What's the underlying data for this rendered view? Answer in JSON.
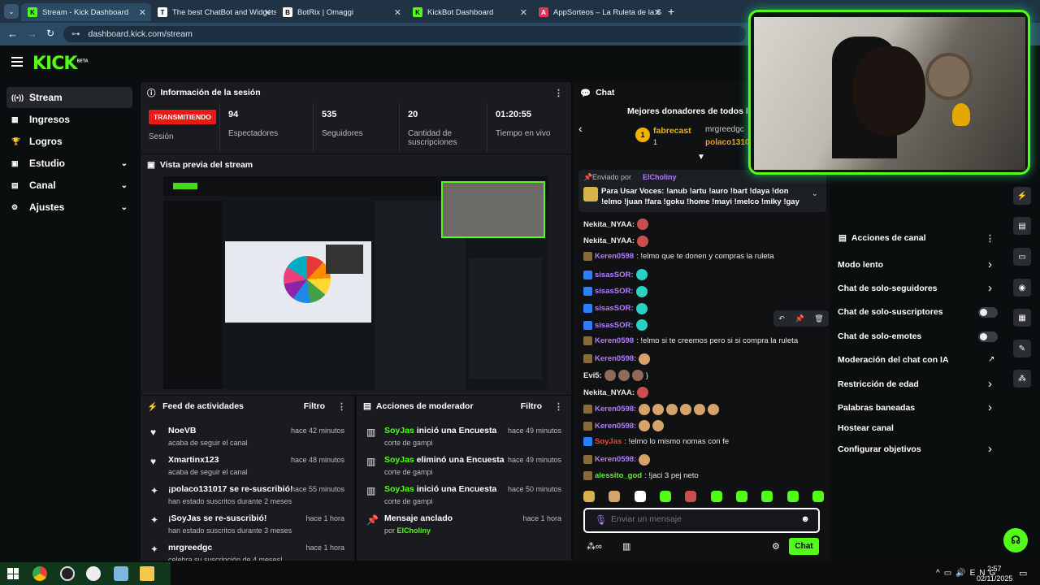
{
  "browser": {
    "tabs": [
      {
        "title": "Stream - Kick Dashboard",
        "fav": "K",
        "favbg": "#53fc18",
        "favfg": "#000"
      },
      {
        "title": "The best ChatBot and Widgets",
        "fav": "T",
        "favbg": "#ffffff",
        "favfg": "#000"
      },
      {
        "title": "BotRix | Omaggi",
        "fav": "B",
        "favbg": "#ffffff",
        "favfg": "#000"
      },
      {
        "title": "KickBot Dashboard",
        "fav": "K",
        "favbg": "#53fc18",
        "favfg": "#000"
      },
      {
        "title": "AppSorteos – La Ruleta de la S",
        "fav": "A",
        "favbg": "#d9385a",
        "favfg": "#fff"
      }
    ],
    "url": "dashboard.kick.com/stream"
  },
  "logo": {
    "text": "KICK",
    "sup": "BETA"
  },
  "sidebar": {
    "items": [
      {
        "label": "Stream",
        "icon": "broadcast-icon",
        "glyph": "((•))"
      },
      {
        "label": "Ingresos",
        "icon": "money-icon",
        "glyph": "▦"
      },
      {
        "label": "Logros",
        "icon": "trophy-icon",
        "glyph": "🏆"
      },
      {
        "label": "Estudio",
        "icon": "studio-icon",
        "glyph": "▣"
      },
      {
        "label": "Canal",
        "icon": "channel-icon",
        "glyph": "▤"
      },
      {
        "label": "Ajustes",
        "icon": "gear-icon",
        "glyph": "⚙"
      }
    ]
  },
  "session": {
    "title": "Información de la sesión",
    "live": "TRANSMITIENDO",
    "live_label": "Sesión",
    "stats": [
      {
        "value": "94",
        "label": "Espectadores"
      },
      {
        "value": "535",
        "label": "Seguidores"
      },
      {
        "value": "20",
        "label": "Cantidad de suscripciones"
      },
      {
        "value": "01:20:55",
        "label": "Tiempo en vivo"
      }
    ]
  },
  "preview": {
    "title": "Vista previa del stream"
  },
  "feed": {
    "title": "Feed de actividades",
    "filter": "Filtro",
    "items": [
      {
        "name": "NoeVB",
        "desc": "acaba de seguir el canal",
        "time": "hace 42 minutos",
        "icon": "heart-icon",
        "glyph": "♥"
      },
      {
        "name": "Xmartinx123",
        "desc": "acaba de seguir el canal",
        "time": "hace 48 minutos",
        "icon": "heart-icon",
        "glyph": "♥"
      },
      {
        "name": "¡polaco131017 se re-suscribió!",
        "desc": "han estado suscritos durante 2 meses",
        "time": "hace 55 minutos",
        "icon": "sparkle-icon",
        "glyph": "✦"
      },
      {
        "name": "¡SoyJas se re-suscribió!",
        "desc": "han estado suscritos durante 3 meses",
        "time": "hace 1 hora",
        "icon": "sparkle-icon",
        "glyph": "✦"
      },
      {
        "name": "mrgreedgc",
        "desc": "celebra su suscripción de 4 meses!",
        "time": "hace 1 hora",
        "icon": "sparkle-icon",
        "glyph": "✦"
      }
    ]
  },
  "modactions": {
    "title": "Acciones de moderador",
    "filter": "Filtro",
    "items": [
      {
        "user": "SoyJas",
        "action": " inició una Encuesta",
        "sub": "corte de gampi",
        "time": "hace 49 minutos",
        "icon": "poll-icon",
        "glyph": "▥"
      },
      {
        "user": "SoyJas",
        "action": " eliminó una Encuesta",
        "sub": "corte de gampi",
        "time": "hace 49 minutos",
        "icon": "poll-icon",
        "glyph": "▥"
      },
      {
        "user": "SoyJas",
        "action": " inició una Encuesta",
        "sub": "corte de gampi",
        "time": "hace 50 minutos",
        "icon": "poll-icon",
        "glyph": "▥"
      },
      {
        "user": "",
        "action": "Mensaje anclado",
        "sub_prefix": "por ",
        "sub": "ElCholiny",
        "time": "hace 1 hora",
        "icon": "pin-icon",
        "glyph": "📌"
      }
    ]
  },
  "chat": {
    "title": "Chat",
    "donors_title": "Mejores donadores de todos los t",
    "donor1": "fabrecast",
    "donor1_count": "1",
    "donor2": "mrgreedgc",
    "donor3": "polaco1310",
    "pinned_by_label": "Enviado por",
    "pinned_by": "ElCholiny",
    "pinned_text": "Para Usar Voces: !anub !artu !auro !bart !daya !don !elmo !juan !fara !goku !home !mayi !melco !miky !gay !mu...",
    "messages": [
      {
        "user": "Nekita_NYAA:",
        "color": "#e8e8e8",
        "text": "",
        "emotes": 1
      },
      {
        "user": "Nekita_NYAA:",
        "color": "#e8e8e8",
        "text": "",
        "emotes": 1
      },
      {
        "user": "Keren0598",
        "color": "#b57cff",
        "text": ": !elmo que te donen y compras la ruleta",
        "emotes": 0
      },
      {
        "user": "sisasSOR:",
        "color": "#b57cff",
        "text": "",
        "emotes": 1
      },
      {
        "user": "sisasSOR:",
        "color": "#b57cff",
        "text": "",
        "emotes": 1
      },
      {
        "user": "sisasSOR:",
        "color": "#b57cff",
        "text": "",
        "emotes": 1
      },
      {
        "user": "sisasSOR:",
        "color": "#b57cff",
        "text": "",
        "emotes": 1
      },
      {
        "user": "Keren0598",
        "color": "#b57cff",
        "text": ": !elmo si te creemos pero si si compra la ruleta",
        "emotes": 0
      },
      {
        "user": "Keren0598:",
        "color": "#b57cff",
        "text": "",
        "emotes": 1
      },
      {
        "user": "Evi5:",
        "color": "#e8e8e8",
        "text": " }",
        "emotes": 3
      },
      {
        "user": "Nekita_NYAA:",
        "color": "#e8e8e8",
        "text": "",
        "emotes": 1
      },
      {
        "user": "Keren0598:",
        "color": "#b57cff",
        "text": "",
        "emotes": 6
      },
      {
        "user": "Keren0598:",
        "color": "#b57cff",
        "text": "",
        "emotes": 2
      },
      {
        "user": "SoyJas",
        "color": "#ff3b3b",
        "text": ": !elmo lo mismo nomas con fe",
        "emotes": 0
      },
      {
        "user": "Keren0598:",
        "color": "#b57cff",
        "text": "",
        "emotes": 1
      },
      {
        "user": "alessito_god",
        "color": "#53fc18",
        "text": ": !jaci 3 pej neto",
        "emotes": 0
      }
    ],
    "placeholder": "Enviar un mensaje",
    "send": "Chat"
  },
  "actions": {
    "title": "Acciones de canal",
    "items": [
      {
        "label": "Modo lento",
        "ctl": "chevron"
      },
      {
        "label": "Chat de solo-seguidores",
        "ctl": "chevron"
      },
      {
        "label": "Chat de solo-suscriptores",
        "ctl": "toggle"
      },
      {
        "label": "Chat de solo-emotes",
        "ctl": "toggle"
      },
      {
        "label": "Moderación del chat con IA",
        "ctl": "external"
      },
      {
        "label": "Restricción de edad",
        "ctl": "chevron"
      },
      {
        "label": "Palabras baneadas",
        "ctl": "chevron"
      },
      {
        "label": "Hostear canal",
        "ctl": "none"
      },
      {
        "label": "Configurar objetivos",
        "ctl": "chevron"
      }
    ]
  },
  "taskbar": {
    "time": "2:57",
    "date": "02/11/2025"
  },
  "colors": {
    "accent": "#53fc18",
    "live": "#e91916",
    "panel": "#191b1f",
    "bg": "#0b0e0f"
  }
}
